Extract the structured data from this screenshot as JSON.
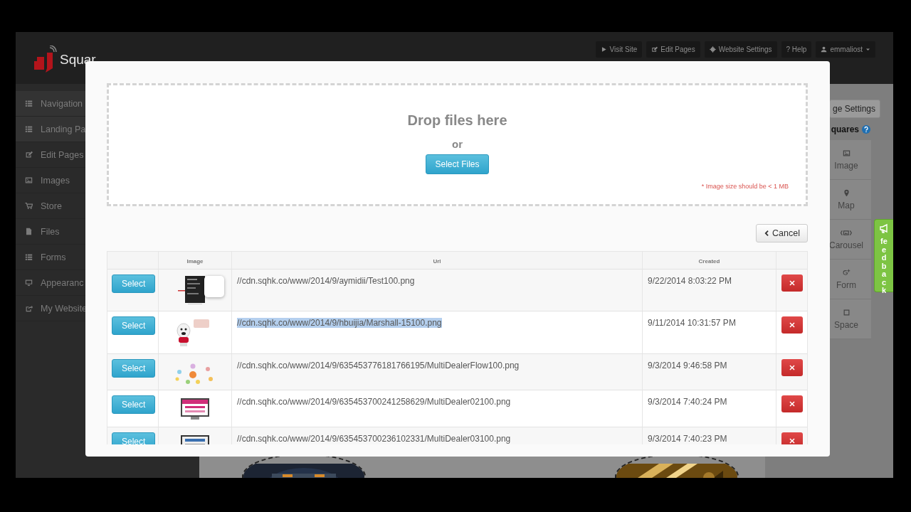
{
  "header": {
    "logo_text": "Squar",
    "nav": [
      {
        "label": "Visit Site",
        "dropdown": false
      },
      {
        "label": "Edit Pages",
        "dropdown": false
      },
      {
        "label": "Website Settings",
        "dropdown": false
      },
      {
        "label": "? Help",
        "dropdown": false
      },
      {
        "label": "emmaliost",
        "dropdown": true
      }
    ]
  },
  "sidebar": {
    "items": [
      {
        "label": "Navigation"
      },
      {
        "label": "Landing Pa"
      },
      {
        "label": "Edit Pages"
      },
      {
        "label": "Images"
      },
      {
        "label": "Store"
      },
      {
        "label": "Files"
      },
      {
        "label": "Forms"
      },
      {
        "label": "Appearanc"
      },
      {
        "label": "My Website"
      }
    ]
  },
  "right_panel": {
    "settings_button": "ge Settings",
    "heading": "quares",
    "tools": [
      {
        "label": "Image"
      },
      {
        "label": "Map"
      },
      {
        "label": "Carousel"
      },
      {
        "label": "Form"
      },
      {
        "label": "Space"
      }
    ]
  },
  "feedback": {
    "label": "feedback"
  },
  "modal": {
    "dropzone": {
      "title": "Drop files here",
      "or": "or",
      "button": "Select Files",
      "note": "* Image size should be < 1 MB"
    },
    "cancel": "Cancel",
    "table": {
      "columns": {
        "image": "Image",
        "url": "Url",
        "created": "Created"
      },
      "rows": [
        {
          "button": "Select",
          "url": "//cdn.sqhk.co/www/2014/9/aymidii/Test100.png",
          "created": "9/22/2014 8:03:22 PM",
          "highlighted": false,
          "popover": true
        },
        {
          "button": "Select",
          "url": "//cdn.sqhk.co/www/2014/9/hbuijia/Marshall-15100.png",
          "created": "9/11/2014 10:31:57 PM",
          "highlighted": true,
          "popover": false
        },
        {
          "button": "Select",
          "url": "//cdn.sqhk.co/www/2014/9/635453776181766195/MultiDealerFlow100.png",
          "created": "9/3/2014 9:46:58 PM",
          "highlighted": false,
          "popover": false
        },
        {
          "button": "Select",
          "url": "//cdn.sqhk.co/www/2014/9/635453700241258629/MultiDealer02100.png",
          "created": "9/3/2014 7:40:24 PM",
          "highlighted": false,
          "popover": false
        },
        {
          "button": "Select",
          "url": "//cdn.sqhk.co/www/2014/9/635453700236102331/MultiDealer03100.png",
          "created": "9/3/2014 7:40:23 PM",
          "highlighted": false,
          "popover": false
        }
      ]
    }
  }
}
